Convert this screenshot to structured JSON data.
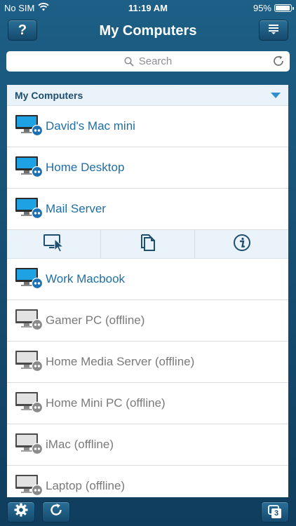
{
  "status_bar": {
    "carrier": "No SIM",
    "time": "11:19 AM",
    "battery_text": "95%",
    "battery_level": 0.95
  },
  "nav": {
    "title": "My Computers",
    "help_label": "?"
  },
  "search": {
    "placeholder": "Search"
  },
  "section": {
    "title": "My Computers"
  },
  "computers": [
    {
      "name": "David's Mac mini",
      "status": "online"
    },
    {
      "name": "Home Desktop",
      "status": "online"
    },
    {
      "name": "Mail Server",
      "status": "online"
    },
    {
      "name": "Work Macbook",
      "status": "online"
    },
    {
      "name": "Gamer PC (offline)",
      "status": "offline"
    },
    {
      "name": "Home Media Server (offline)",
      "status": "offline"
    },
    {
      "name": "Home Mini PC (offline)",
      "status": "offline"
    },
    {
      "name": "iMac (offline)",
      "status": "offline"
    },
    {
      "name": "Laptop (offline)",
      "status": "offline"
    }
  ],
  "colors": {
    "online_accent": "#1f6ea4",
    "offline_text": "#7a7a7a",
    "nav_bg": "#1d5f86"
  },
  "toolbar": {
    "session_count": "3"
  }
}
